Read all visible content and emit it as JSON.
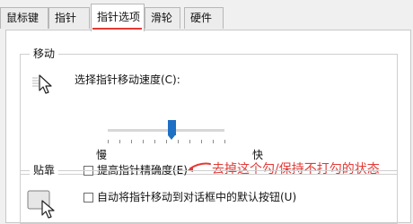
{
  "tabs": [
    {
      "label": "鼠标键"
    },
    {
      "label": "指针"
    },
    {
      "label": "指针选项"
    },
    {
      "label": "滑轮"
    },
    {
      "label": "硬件"
    }
  ],
  "active_tab": "指针选项",
  "motion": {
    "legend": "移动",
    "speed_label": "选择指针移动速度(C):",
    "slow_label": "慢",
    "fast_label": "快",
    "speed_level": 0.55,
    "precision_checkbox": {
      "label": "提高指针精确度(E)",
      "checked": false
    }
  },
  "annotation": {
    "text": "去掉这个勾/保持不打勾的状态",
    "color": "#e53935"
  },
  "snap": {
    "legend": "贴靠",
    "checkbox": {
      "label": "自动将指针移动到对话框中的默认按钮(U)",
      "checked": false
    }
  },
  "icons": {
    "motion_icon": "pointer-trails-icon",
    "snap_icon": "snap-to-button-icon",
    "annotation_arrow": "red-arrow-icon"
  }
}
